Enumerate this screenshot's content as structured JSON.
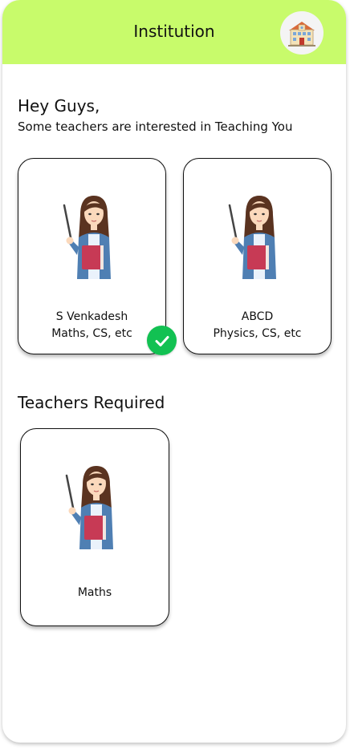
{
  "header": {
    "title": "Institution",
    "avatar_icon": "school-building-icon"
  },
  "greeting": {
    "title": "Hey Guys,",
    "subtitle": "Some teachers are interested in Teaching You"
  },
  "interested_teachers": [
    {
      "name": "S Venkadesh",
      "subjects": "Maths, CS, etc",
      "selected": true
    },
    {
      "name": "ABCD",
      "subjects": "Physics, CS, etc",
      "selected": false
    }
  ],
  "required_section": {
    "title": "Teachers Required",
    "cards": [
      {
        "subject": "Maths"
      }
    ]
  },
  "colors": {
    "header": "#c8fb6b",
    "check": "#12c152"
  }
}
